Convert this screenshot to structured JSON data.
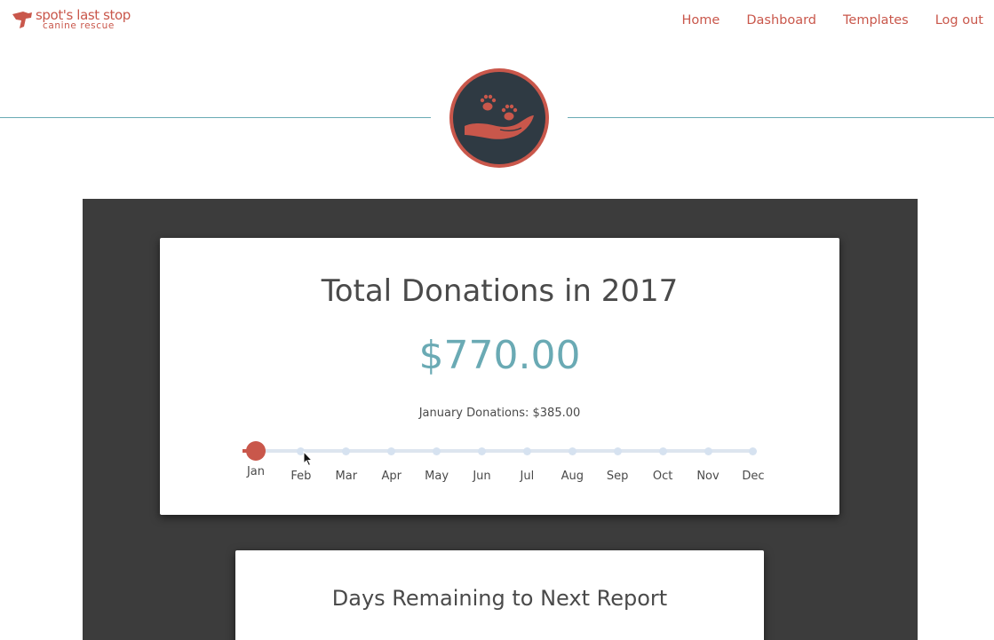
{
  "header": {
    "logo_name": "spot's last stop",
    "logo_sub": "canine rescue",
    "nav": [
      "Home",
      "Dashboard",
      "Templates",
      "Log out"
    ]
  },
  "badge": {
    "icon": "hand-with-paws-icon"
  },
  "donations_card": {
    "title": "Total Donations in 2017",
    "total": "$770.00",
    "month_label": "January Donations:",
    "month_value": "$385.00",
    "months": [
      "Jan",
      "Feb",
      "Mar",
      "Apr",
      "May",
      "Jun",
      "Jul",
      "Aug",
      "Sep",
      "Oct",
      "Nov",
      "Dec"
    ],
    "selected_month": "Jan"
  },
  "report_card": {
    "title": "Days Remaining to Next Report"
  },
  "colors": {
    "accent_red": "#c9574b",
    "accent_teal": "#6aaab4",
    "dark_band": "#3c3c3c",
    "badge_inner": "#2f3a43"
  }
}
